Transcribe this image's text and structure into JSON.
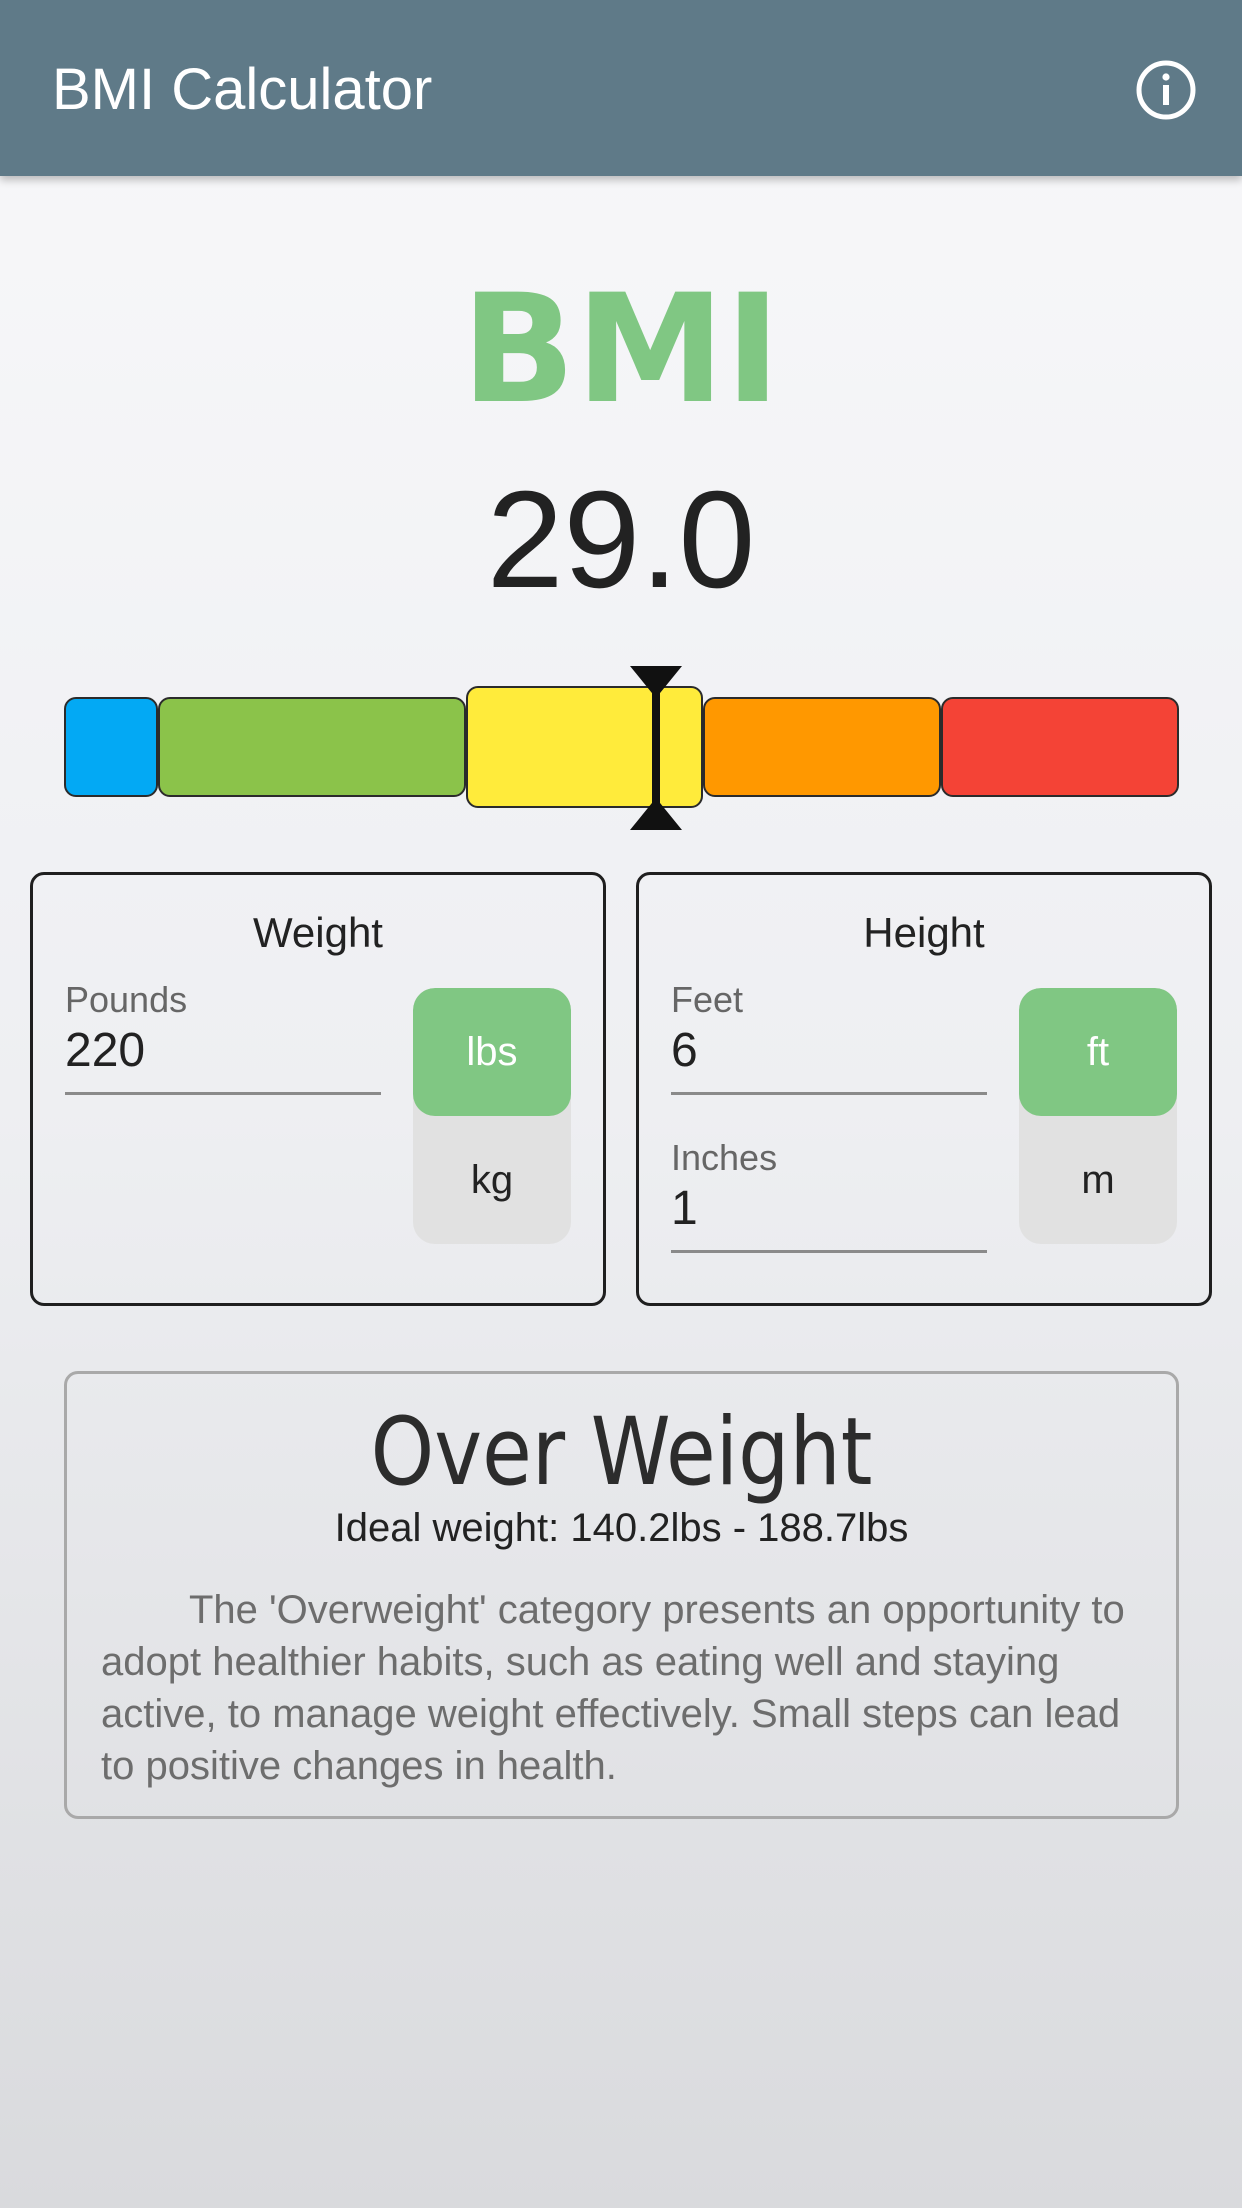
{
  "app": {
    "title": "BMI Calculator",
    "info_icon": "info-circle-icon"
  },
  "bmi": {
    "label": "BMI",
    "value": "29.0",
    "label_color": "#80c783"
  },
  "scale": {
    "segments": [
      {
        "name": "underweight",
        "color": "#03a9f4"
      },
      {
        "name": "normal",
        "color": "#8bc34a"
      },
      {
        "name": "overweight",
        "color": "#ffeb3b",
        "active": true
      },
      {
        "name": "obese",
        "color": "#ff9800"
      },
      {
        "name": "extremely-obese",
        "color": "#f44336"
      }
    ],
    "marker_icon": "bmi-marker-icon"
  },
  "weight": {
    "title": "Weight",
    "field_label": "Pounds",
    "value": "220",
    "units": {
      "active": "lbs",
      "inactive": "kg"
    }
  },
  "height": {
    "title": "Height",
    "feet_label": "Feet",
    "feet_value": "6",
    "inches_label": "Inches",
    "inches_value": "1",
    "units": {
      "active": "ft",
      "inactive": "m"
    }
  },
  "result": {
    "category": "Over Weight",
    "ideal": "Ideal weight: 140.2lbs - 188.7lbs",
    "description": "The 'Overweight' category presents an opportunity to adopt healthier habits, such as eating well and staying active, to manage weight effectively. Small steps can lead to positive changes in health."
  },
  "colors": {
    "appbar": "#5f7a88",
    "accent": "#80c783"
  }
}
